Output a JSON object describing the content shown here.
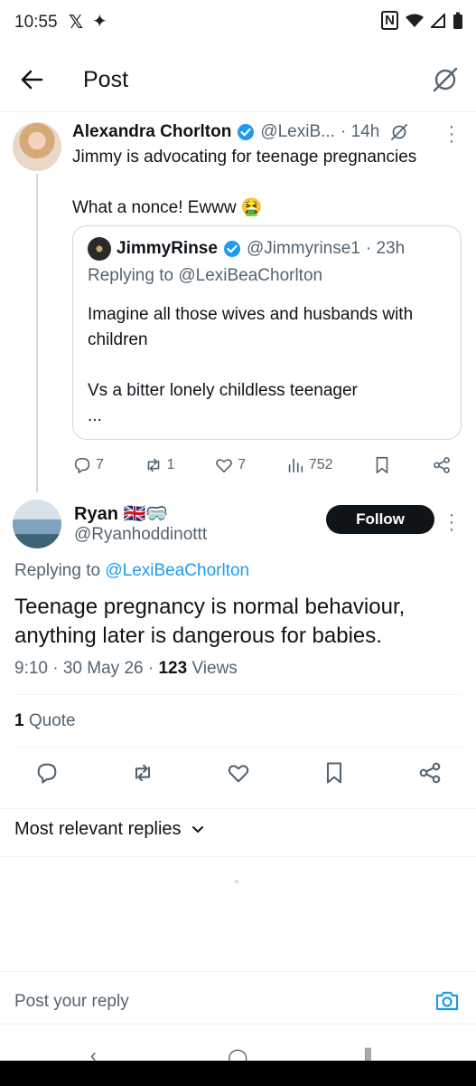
{
  "status_bar": {
    "time": "10:55"
  },
  "header": {
    "title": "Post"
  },
  "parent_tweet": {
    "name": "Alexandra Chorlton",
    "handle": "@LexiB...",
    "time": "· 14h",
    "text": "Jimmy is advocating for teenage pregnancies\n\nWhat a nonce! Ewww 🤮",
    "quote": {
      "name": "JimmyRinse",
      "handle": "@Jimmyrinse1",
      "time": "· 23h",
      "replying_to": "Replying to @LexiBeaChorlton",
      "text": "Imagine all those wives and husbands with children\n\nVs a bitter lonely childless teenager\n..."
    },
    "stats": {
      "replies": "7",
      "reposts": "1",
      "likes": "7",
      "views": "752"
    }
  },
  "main_tweet": {
    "name": "Ryan 🇬🇧🥽",
    "handle": "@Ryanhoddinottt",
    "follow_label": "Follow",
    "replying_prefix": "Replying to",
    "replying_handle": "@LexiBeaChorlton",
    "text": "Teenage pregnancy is normal behaviour, anything later is dangerous for babies.",
    "time": "9:10 · 30 May 26 ·",
    "views_count": "123",
    "views_label": "Views",
    "quote_count": "1",
    "quote_label": "Quote"
  },
  "sort_label": "Most relevant replies",
  "reply_placeholder": "Post your reply",
  "colors": {
    "accent": "#1d9bf0",
    "text": "#0f1419",
    "muted": "#536471",
    "verified": "#1d9bf0"
  }
}
